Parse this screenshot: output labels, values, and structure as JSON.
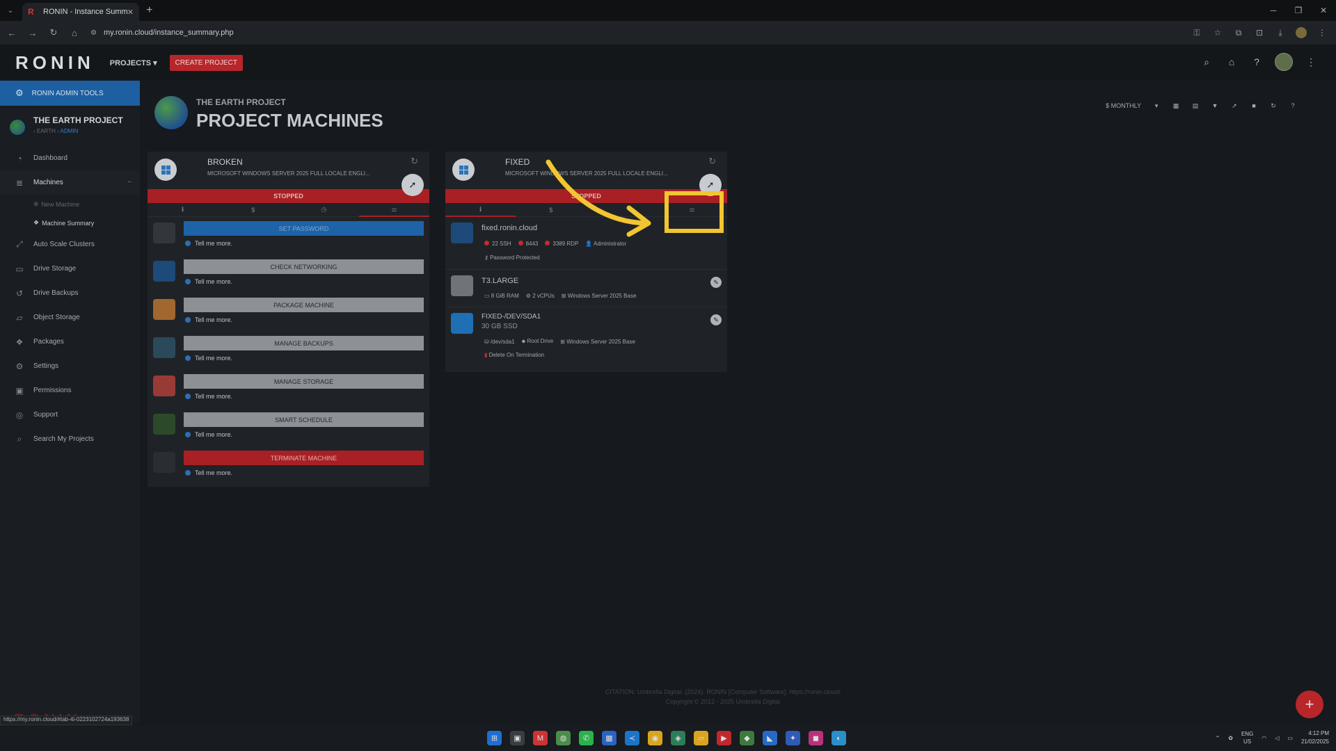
{
  "browser": {
    "tab_title": "RONIN - Instance Summary",
    "url": "my.ronin.cloud/instance_summary.php",
    "status_url": "https://my.ronin.cloud/#tab-4i-0223102724a193638"
  },
  "header": {
    "logo": "RONIN",
    "projects_label": "PROJECTS",
    "create_project_label": "CREATE PROJECT"
  },
  "sidebar": {
    "admin_tools": "RONIN ADMIN TOOLS",
    "project_name": "THE EARTH PROJECT",
    "project_sub": "‹ EARTH ›",
    "project_role": "ADMIN",
    "items": [
      {
        "label": "Dashboard"
      },
      {
        "label": "Machines"
      },
      {
        "label": "Auto Scale Clusters"
      },
      {
        "label": "Drive Storage"
      },
      {
        "label": "Drive Backups"
      },
      {
        "label": "Object Storage"
      },
      {
        "label": "Packages"
      },
      {
        "label": "Settings"
      },
      {
        "label": "Permissions"
      },
      {
        "label": "Support"
      },
      {
        "label": "Search My Projects"
      }
    ],
    "sub_items": [
      {
        "label": "New Machine"
      },
      {
        "label": "Machine Summary"
      }
    ],
    "footer_logo": "RONIN"
  },
  "page": {
    "supertitle": "THE EARTH PROJECT",
    "title": "PROJECT MACHINES",
    "billing_label": "$ MONTHLY"
  },
  "broken": {
    "name": "BROKEN",
    "os": "MICROSOFT WINDOWS SERVER 2025 FULL LOCALE ENGLI...",
    "state": "STOPPED",
    "actions": [
      {
        "label": "SET PASSWORD",
        "more": "Tell me more."
      },
      {
        "label": "CHECK NETWORKING",
        "more": "Tell me more."
      },
      {
        "label": "PACKAGE MACHINE",
        "more": "Tell me more."
      },
      {
        "label": "MANAGE BACKUPS",
        "more": "Tell me more."
      },
      {
        "label": "MANAGE STORAGE",
        "more": "Tell me more."
      },
      {
        "label": "SMART SCHEDULE",
        "more": "Tell me more."
      },
      {
        "label": "TERMINATE MACHINE",
        "more": "Tell me more."
      }
    ]
  },
  "fixed": {
    "name": "FIXED",
    "os": "MICROSOFT WINDOWS SERVER 2025 FULL LOCALE ENGLI...",
    "state": "STOPPED",
    "host": "fixed.ronin.cloud",
    "ports": [
      "22 SSH",
      "8443",
      "3389 RDP"
    ],
    "user": "Administrator",
    "password": "Password Protected",
    "instance_type": "T3.LARGE",
    "ram": "8 GiB RAM",
    "vcpus": "2 vCPUs",
    "image": "Windows Server 2025 Base",
    "volume_name": "FIXED-/DEV/SDA1",
    "volume_size": "30 GB SSD",
    "device": "/dev/sda1",
    "drive_tag": "Root Drive",
    "volume_image": "Windows Server 2025 Base",
    "delete_on_term": "Delete On Termination"
  },
  "footer": {
    "citation": "CITATION: Umbrella Digital. (2024). RONIN [Computer Software]. https://ronin.cloud/",
    "copyright": "Copyright © 2012 - 2025 Umbrella Digital"
  },
  "taskbar": {
    "lang1": "ENG",
    "lang2": "US",
    "time": "4:12 PM",
    "date": "21/02/2025"
  },
  "colors": {
    "accent_red": "#a82024",
    "accent_blue": "#1e63a8",
    "highlight_yellow": "#f2c531"
  }
}
